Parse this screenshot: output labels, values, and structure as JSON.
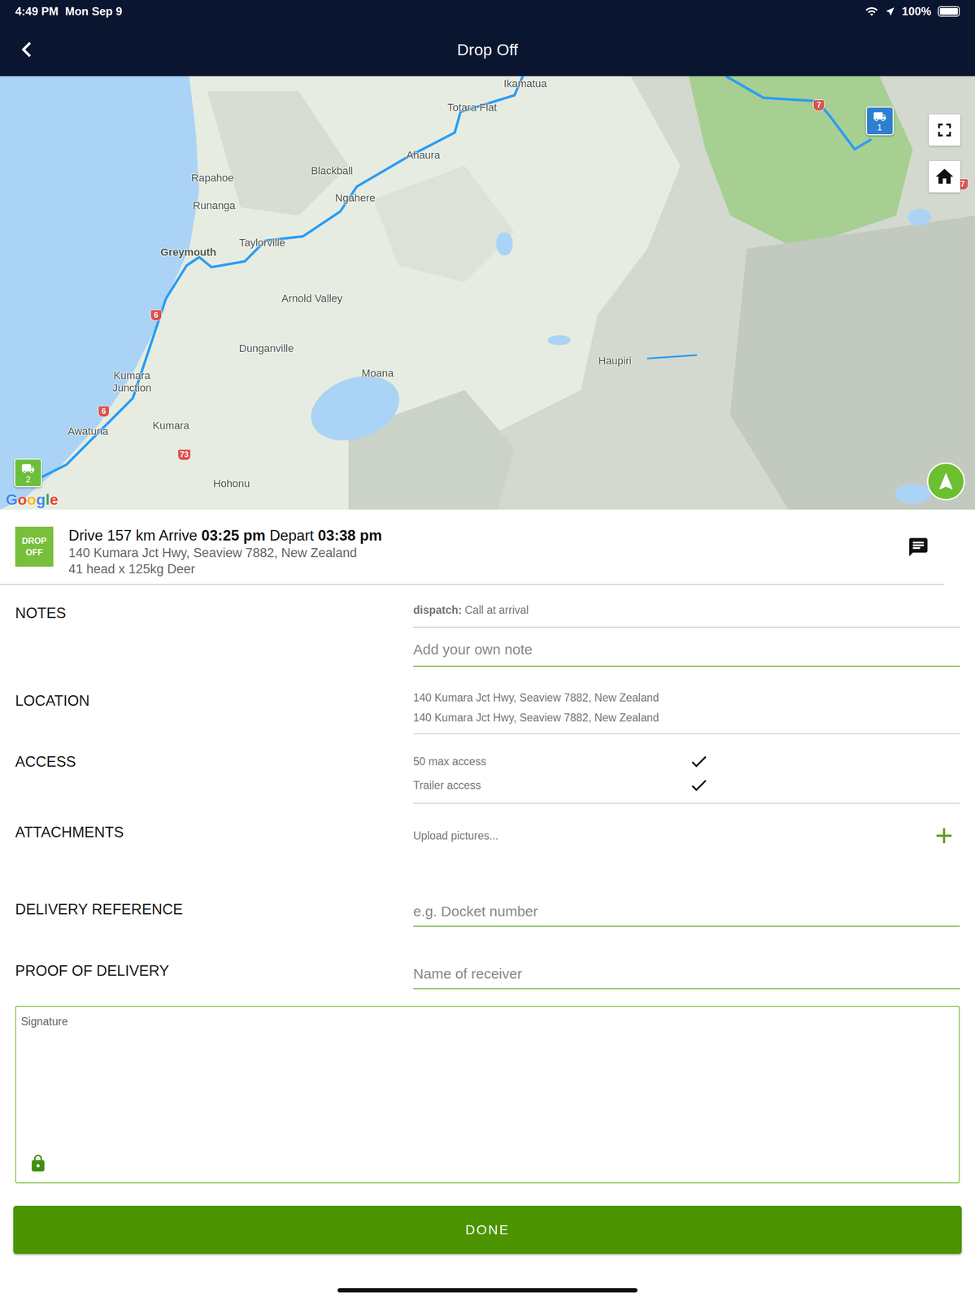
{
  "status_bar": {
    "time": "4:49 PM",
    "date": "Mon Sep 9",
    "battery": "100%",
    "battery_level": 1
  },
  "nav": {
    "title": "Drop Off"
  },
  "map": {
    "places": [
      "Ikamatua",
      "Totara Flat",
      "Ahaura",
      "Rapahoe",
      "Blackball",
      "Runanga",
      "Ngahere",
      "Taylorville",
      "Greymouth",
      "Arnold Valley",
      "Dunganville",
      "Moana",
      "Haupiri",
      "Kumara\nJunction",
      "Awatuna",
      "Kumara",
      "Hohonu"
    ],
    "roads": [
      "7",
      "7",
      "6",
      "6",
      "73"
    ],
    "pins": [
      {
        "label": "1",
        "color": "#2f7fd1"
      },
      {
        "label": "2",
        "color": "#6bbf3a"
      }
    ],
    "attribution": "Google"
  },
  "stop": {
    "badge": "DROP OFF",
    "drive": "Drive 157 km",
    "arrive_label": "Arrive",
    "arrive": "03:25 pm",
    "depart_label": "Depart",
    "depart": "03:38 pm",
    "address": "140 Kumara Jct Hwy, Seaview 7882, New Zealand",
    "cargo": "41 head x 125kg Deer"
  },
  "notes": {
    "label": "NOTES",
    "dispatch_author": "dispatch:",
    "dispatch_text": "Call at arrival",
    "placeholder": "Add your own note"
  },
  "location": {
    "label": "LOCATION",
    "lines": [
      "140 Kumara Jct Hwy, Seaview 7882, New Zealand",
      "140 Kumara Jct Hwy, Seaview 7882, New Zealand"
    ]
  },
  "access": {
    "label": "ACCESS",
    "items": [
      {
        "label": "50 max access",
        "checked": true
      },
      {
        "label": "Trailer access",
        "checked": true
      }
    ]
  },
  "attachments": {
    "label": "ATTACHMENTS",
    "placeholder": "Upload pictures..."
  },
  "delivery_reference": {
    "label": "DELIVERY REFERENCE",
    "placeholder": "e.g. Docket number"
  },
  "proof_of_delivery": {
    "label": "PROOF OF DELIVERY",
    "placeholder": "Name of receiver",
    "signature_label": "Signature",
    "locked": true
  },
  "buttons": [
    "DONE"
  ]
}
